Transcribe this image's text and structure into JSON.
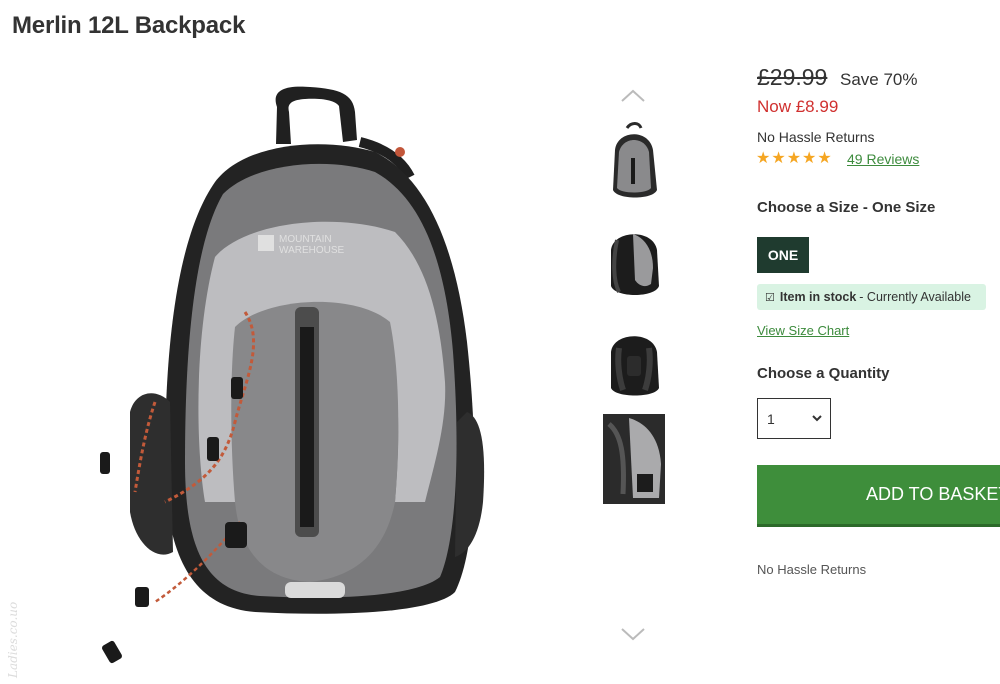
{
  "product": {
    "title": "Merlin 12L Backpack"
  },
  "gallery": {
    "main_image_alt": "Grey Mountain Warehouse backpack, front view",
    "main_logo_text_1": "MOUNTAIN",
    "main_logo_text_2": "WAREHOUSE",
    "thumbnails": [
      "front",
      "side-black",
      "back-black",
      "open-inside"
    ]
  },
  "pricing": {
    "old_price": "£29.99",
    "save_text": "Save 70%",
    "now_price": "Now £8.99"
  },
  "returns_text": "No Hassle Returns",
  "rating": {
    "stars": 5,
    "reviews_label": "49 Reviews"
  },
  "size": {
    "label": "Choose a Size - One Size",
    "option": "ONE"
  },
  "stock": {
    "status": "Item in stock",
    "detail": "- Currently Available"
  },
  "size_chart_label": "View Size Chart",
  "quantity": {
    "label": "Choose a Quantity",
    "value": "1"
  },
  "add_to_basket_label": "ADD TO BASKET",
  "returns_footer": "No Hassle Returns",
  "colors": {
    "price_now": "#d0302f",
    "link_green": "#3d8b3d",
    "basket_button": "#3e8e3b",
    "size_button": "#1f3b2f",
    "stock_badge_bg": "#d9f3e3",
    "star": "#f5a623"
  },
  "watermark_text": "Ladies.co.uo"
}
